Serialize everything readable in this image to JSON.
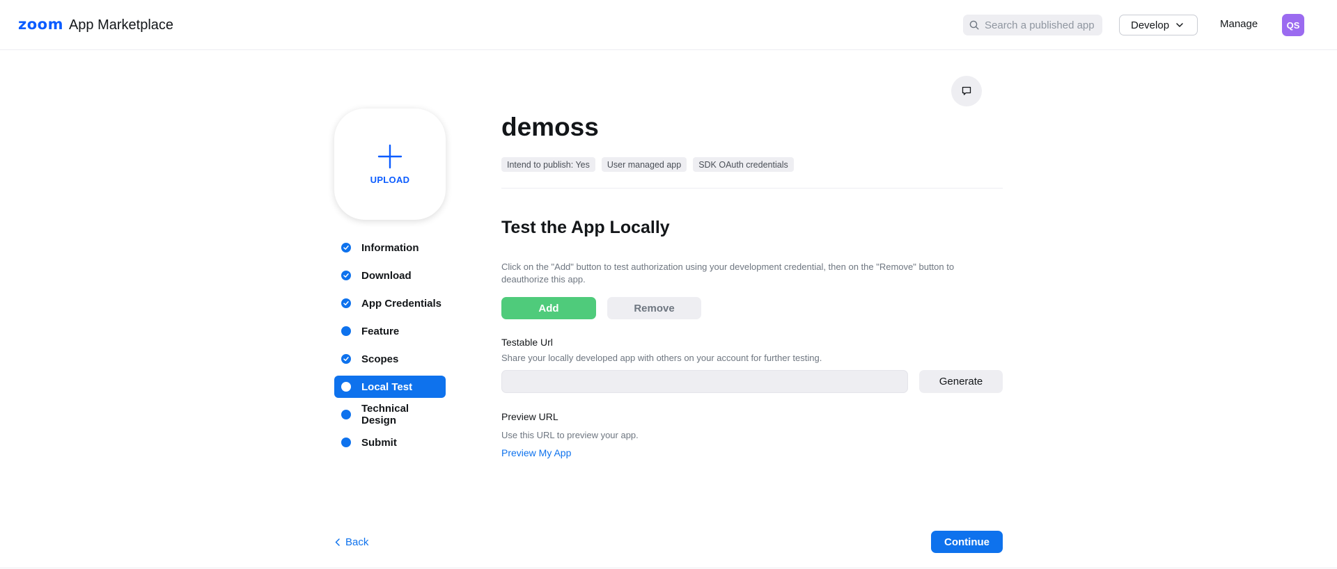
{
  "header": {
    "logo_brand": "zoom",
    "logo_text": "App Marketplace",
    "search_placeholder": "Search a published app",
    "develop_label": "Develop",
    "manage_label": "Manage",
    "avatar_initials": "QS"
  },
  "upload": {
    "label": "UPLOAD"
  },
  "steps": [
    {
      "label": "Information",
      "status": "complete"
    },
    {
      "label": "Download",
      "status": "complete"
    },
    {
      "label": "App Credentials",
      "status": "complete"
    },
    {
      "label": "Feature",
      "status": "incomplete"
    },
    {
      "label": "Scopes",
      "status": "complete"
    },
    {
      "label": "Local Test",
      "status": "active"
    },
    {
      "label": "Technical Design",
      "status": "incomplete"
    },
    {
      "label": "Submit",
      "status": "incomplete"
    }
  ],
  "app": {
    "name": "demoss",
    "tags": [
      "Intend to publish: Yes",
      "User managed app",
      "SDK OAuth credentials"
    ]
  },
  "local_test": {
    "title": "Test the App Locally",
    "description": "Click on the \"Add\" button to test authorization using your development credential, then on the \"Remove\" button to deauthorize this app.",
    "add_label": "Add",
    "remove_label": "Remove"
  },
  "testable_url": {
    "label": "Testable Url",
    "description": "Share your locally developed app with others on your account for further testing.",
    "value": "",
    "generate_label": "Generate"
  },
  "preview_url": {
    "label": "Preview URL",
    "description": "Use this URL to preview your app.",
    "link_label": "Preview My App"
  },
  "footer": {
    "back_label": "Back",
    "continue_label": "Continue"
  },
  "colors": {
    "brand_blue": "#0b5cff",
    "primary_blue": "#0e72ed",
    "add_green": "#4fcb7b",
    "avatar_purple": "#9b6bf0"
  }
}
